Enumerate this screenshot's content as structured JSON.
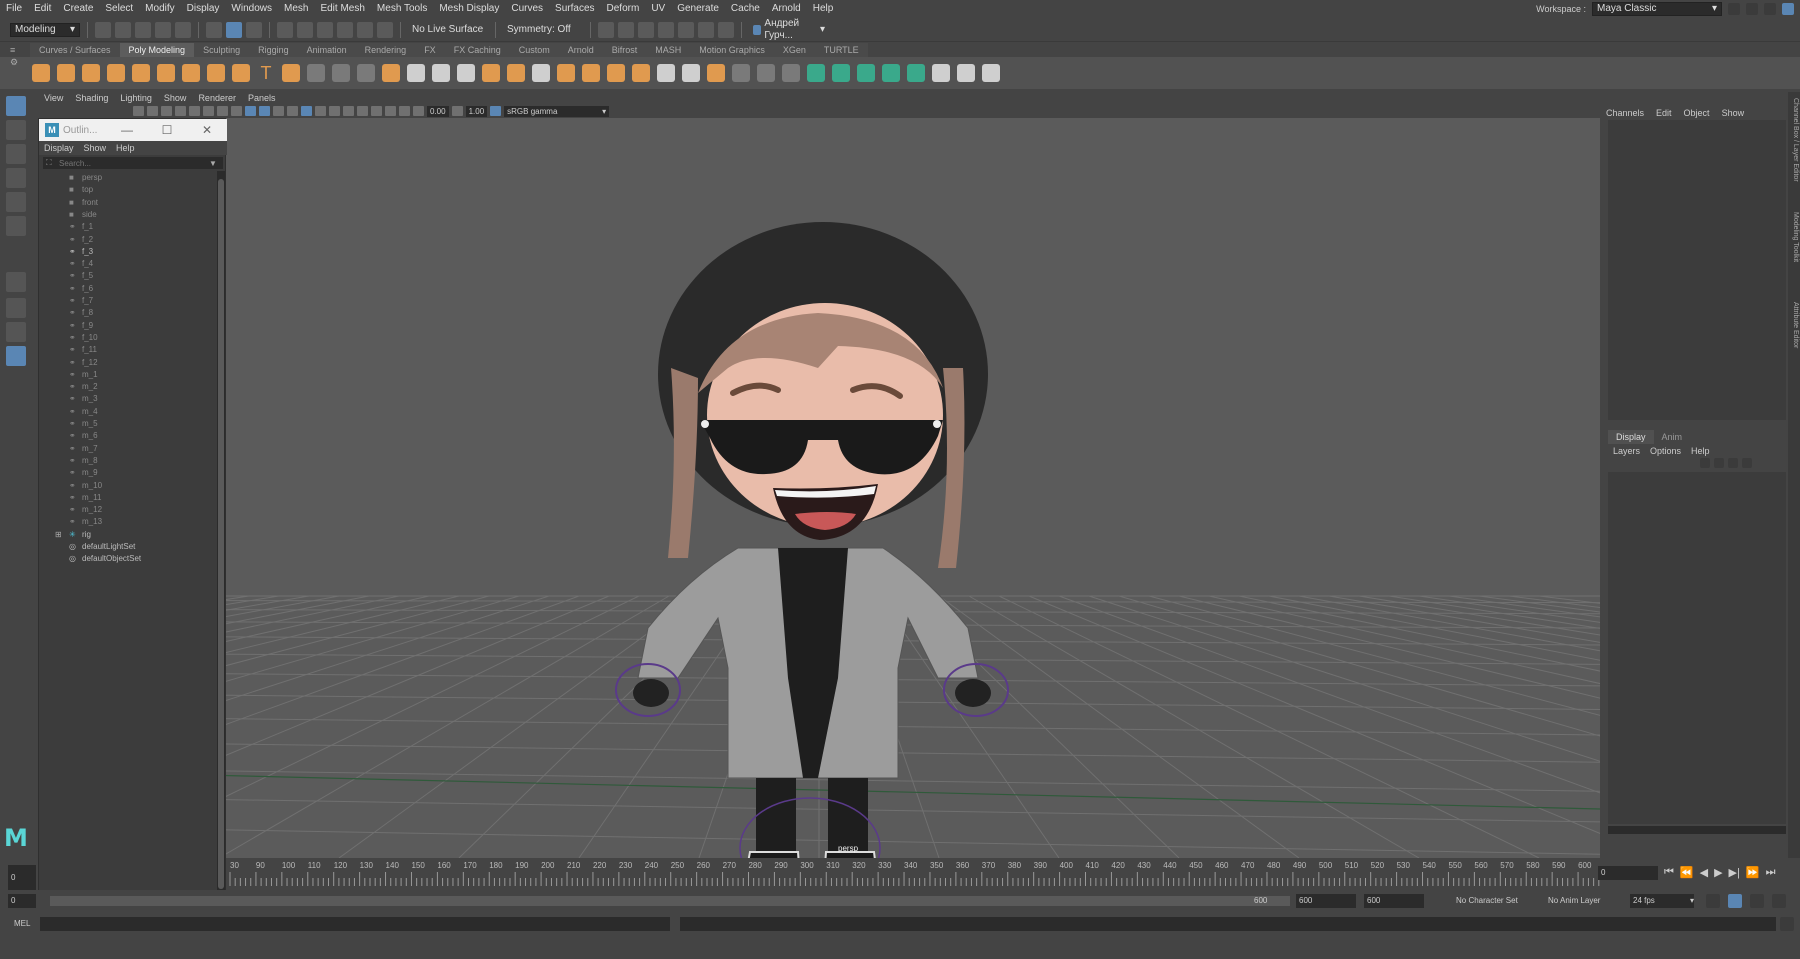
{
  "menubar": {
    "items": [
      "File",
      "Edit",
      "Create",
      "Select",
      "Modify",
      "Display",
      "Windows",
      "Mesh",
      "Edit Mesh",
      "Mesh Tools",
      "Mesh Display",
      "Curves",
      "Surfaces",
      "Deform",
      "UV",
      "Generate",
      "Cache",
      "Arnold",
      "Help"
    ],
    "workspace_label": "Workspace :",
    "workspace_value": "Maya Classic"
  },
  "statusline": {
    "mode": "Modeling",
    "live_surface": "No Live Surface",
    "symmetry": "Symmetry: Off",
    "user": "Андрей Гурч..."
  },
  "shelf": {
    "tabs": [
      "Curves / Surfaces",
      "Poly Modeling",
      "Sculpting",
      "Rigging",
      "Animation",
      "Rendering",
      "FX",
      "FX Caching",
      "Custom",
      "Arnold",
      "Bifrost",
      "MASH",
      "Motion Graphics",
      "XGen",
      "TURTLE"
    ],
    "active_tab": "Poly Modeling"
  },
  "viewport": {
    "menu": [
      "View",
      "Shading",
      "Lighting",
      "Show",
      "Renderer",
      "Panels"
    ],
    "exposure": "0.00",
    "gamma": "1.00",
    "color_space": "sRGB gamma",
    "camera_label": "persp"
  },
  "outliner": {
    "title": "Outlin...",
    "menu": [
      "Display",
      "Show",
      "Help"
    ],
    "search_placeholder": "Search...",
    "items": [
      {
        "label": "persp",
        "type": "camera",
        "dim": true
      },
      {
        "label": "top",
        "type": "camera",
        "dim": true
      },
      {
        "label": "front",
        "type": "camera",
        "dim": true
      },
      {
        "label": "side",
        "type": "camera",
        "dim": true
      },
      {
        "label": "f_1",
        "type": "joint",
        "dim": true
      },
      {
        "label": "f_2",
        "type": "joint",
        "dim": true
      },
      {
        "label": "f_3",
        "type": "joint",
        "dim": false
      },
      {
        "label": "f_4",
        "type": "joint",
        "dim": true
      },
      {
        "label": "f_5",
        "type": "joint",
        "dim": true
      },
      {
        "label": "f_6",
        "type": "joint",
        "dim": true
      },
      {
        "label": "f_7",
        "type": "joint",
        "dim": true
      },
      {
        "label": "f_8",
        "type": "joint",
        "dim": true
      },
      {
        "label": "f_9",
        "type": "joint",
        "dim": true
      },
      {
        "label": "f_10",
        "type": "joint",
        "dim": true
      },
      {
        "label": "f_11",
        "type": "joint",
        "dim": true
      },
      {
        "label": "f_12",
        "type": "joint",
        "dim": true
      },
      {
        "label": "m_1",
        "type": "joint",
        "dim": true
      },
      {
        "label": "m_2",
        "type": "joint",
        "dim": true
      },
      {
        "label": "m_3",
        "type": "joint",
        "dim": true
      },
      {
        "label": "m_4",
        "type": "joint",
        "dim": true
      },
      {
        "label": "m_5",
        "type": "joint",
        "dim": true
      },
      {
        "label": "m_6",
        "type": "joint",
        "dim": true
      },
      {
        "label": "m_7",
        "type": "joint",
        "dim": true
      },
      {
        "label": "m_8",
        "type": "joint",
        "dim": true
      },
      {
        "label": "m_9",
        "type": "joint",
        "dim": true
      },
      {
        "label": "m_10",
        "type": "joint",
        "dim": true
      },
      {
        "label": "m_11",
        "type": "joint",
        "dim": true
      },
      {
        "label": "m_12",
        "type": "joint",
        "dim": true
      },
      {
        "label": "m_13",
        "type": "joint",
        "dim": true
      },
      {
        "label": "rig",
        "type": "group",
        "dim": false
      },
      {
        "label": "defaultLightSet",
        "type": "set",
        "dim": false
      },
      {
        "label": "defaultObjectSet",
        "type": "set",
        "dim": false
      }
    ]
  },
  "channelbox": {
    "menu": [
      "Channels",
      "Edit",
      "Object",
      "Show"
    ],
    "side_tabs": [
      "Channel Box / Layer Editor",
      "Modeling Toolkit",
      "Attribute Editor"
    ]
  },
  "layers": {
    "tabs": [
      "Display",
      "Anim"
    ],
    "active_tab": "Display",
    "menu": [
      "Layers",
      "Options",
      "Help"
    ]
  },
  "timeline": {
    "ticks": [
      "30",
      "90",
      "100",
      "110",
      "120",
      "130",
      "140",
      "150",
      "160",
      "170",
      "180",
      "190",
      "200",
      "210",
      "220",
      "230",
      "240",
      "250",
      "260",
      "270",
      "280",
      "290",
      "300",
      "310",
      "320",
      "330",
      "340",
      "350",
      "360",
      "370",
      "380",
      "390",
      "400",
      "410",
      "420",
      "430",
      "440",
      "450",
      "460",
      "470",
      "480",
      "490",
      "500",
      "510",
      "520",
      "530",
      "540",
      "550",
      "560",
      "570",
      "580",
      "590",
      "600"
    ],
    "current_frame": "0",
    "current_frame_right": "0"
  },
  "range": {
    "start": "0",
    "range_end": "600",
    "playback_end": "600",
    "anim_end": "600",
    "character_set": "No Character Set",
    "anim_layer": "No Anim Layer",
    "fps": "24 fps"
  },
  "cmdline": {
    "label": "MEL"
  },
  "colors": {
    "accent": "#5a86b4",
    "shelf_orange": "#e09a4f",
    "shelf_green": "#3aa98b",
    "viewport_bg": "#5b5b5b"
  }
}
